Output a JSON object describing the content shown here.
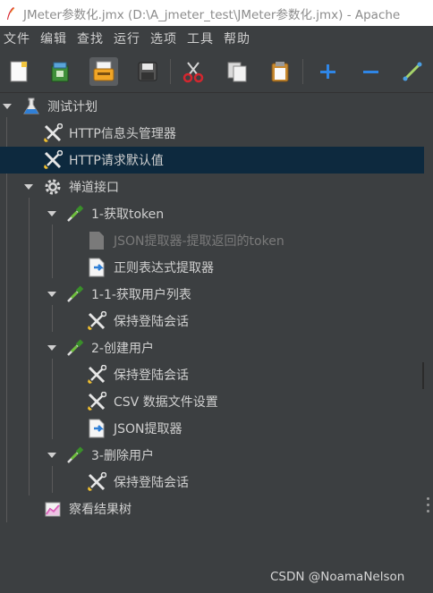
{
  "window": {
    "title": "JMeter参数化.jmx (D:\\A_jmeter_test\\JMeter参数化.jmx) - Apache"
  },
  "menu": [
    "文件",
    "编辑",
    "查找",
    "运行",
    "选项",
    "工具",
    "帮助"
  ],
  "toolbar": {
    "buttons": [
      "new-icon",
      "templates-icon",
      "open-icon",
      "save-icon",
      "cut-icon",
      "copy-icon",
      "paste-icon",
      "expand-icon",
      "collapse-icon",
      "toggle-icon"
    ]
  },
  "tree": {
    "nodes": [
      {
        "label": "测试计划",
        "icon": "test-plan-icon",
        "expanded": true
      },
      {
        "label": "HTTP信息头管理器",
        "icon": "config-element-icon"
      },
      {
        "label": "HTTP请求默认值",
        "icon": "config-element-icon",
        "selected": true
      },
      {
        "label": "禅道接口",
        "icon": "thread-group-icon",
        "expanded": true
      },
      {
        "label": "1-获取token",
        "icon": "sampler-icon",
        "expanded": true
      },
      {
        "label": "JSON提取器-提取返回的token",
        "icon": "post-processor-icon",
        "disabled": true
      },
      {
        "label": "正则表达式提取器",
        "icon": "post-processor-icon"
      },
      {
        "label": "1-1-获取用户列表",
        "icon": "sampler-icon",
        "expanded": true
      },
      {
        "label": "保持登陆会话",
        "icon": "config-element-icon"
      },
      {
        "label": "2-创建用户",
        "icon": "sampler-icon",
        "expanded": true
      },
      {
        "label": "保持登陆会话",
        "icon": "config-element-icon"
      },
      {
        "label": "CSV 数据文件设置",
        "icon": "config-element-icon"
      },
      {
        "label": "JSON提取器",
        "icon": "post-processor-icon"
      },
      {
        "label": "3-删除用户",
        "icon": "sampler-icon",
        "expanded": true
      },
      {
        "label": "保持登陆会话",
        "icon": "config-element-icon"
      },
      {
        "label": "察看结果树",
        "icon": "listener-icon"
      }
    ]
  },
  "watermark": "CSDN @NoamaNelson",
  "colors": {
    "background": "#3c3f41",
    "selected_row": "#0d293e",
    "text": "#d0d0d0",
    "disabled_text": "#7a7a7a"
  }
}
